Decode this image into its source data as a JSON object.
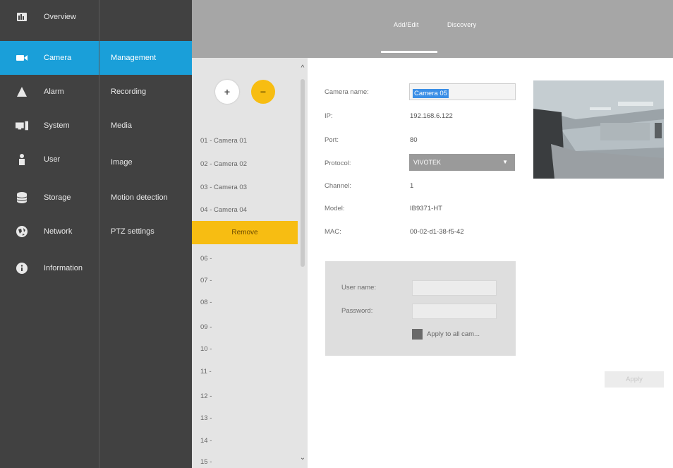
{
  "nav": {
    "items": [
      {
        "label": "Overview",
        "icon": "overview-icon"
      },
      {
        "label": "Camera",
        "icon": "camera-icon",
        "active": true
      },
      {
        "label": "Alarm",
        "icon": "alarm-icon"
      },
      {
        "label": "System",
        "icon": "system-icon"
      },
      {
        "label": "User",
        "icon": "user-icon"
      },
      {
        "label": "Storage",
        "icon": "storage-icon"
      },
      {
        "label": "Network",
        "icon": "network-icon"
      },
      {
        "label": "Information",
        "icon": "information-icon"
      }
    ]
  },
  "subnav": {
    "items": [
      {
        "label": "Management",
        "active": true
      },
      {
        "label": "Recording"
      },
      {
        "label": "Media"
      },
      {
        "label": "Image"
      },
      {
        "label": "Motion detection"
      },
      {
        "label": "PTZ settings"
      }
    ]
  },
  "header": {
    "tabs": [
      {
        "label": "Add/Edit",
        "active": true
      },
      {
        "label": "Discovery"
      }
    ]
  },
  "list": {
    "add_label": "+",
    "remove_label": "−",
    "cameras": [
      "01 - Camera 01",
      "02 - Camera 02",
      "03 - Camera 03",
      "04 - Camera 04",
      "Remove",
      "06 -",
      "07 -",
      "08 -",
      "09 -",
      "10 -",
      "11 -",
      "12 -",
      "13 -",
      "14 -",
      "15 -"
    ]
  },
  "form": {
    "camera_name_label": "Camera name:",
    "camera_name_value": "Camera 05",
    "ip_label": "IP:",
    "ip_value": "192.168.6.122",
    "port_label": "Port:",
    "port_value": "80",
    "protocol_label": "Protocol:",
    "protocol_value": "VIVOTEK",
    "channel_label": "Channel:",
    "channel_value": "1",
    "model_label": "Model:",
    "model_value": "IB9371-HT",
    "mac_label": "MAC:",
    "mac_value": "00-02-d1-38-f5-42"
  },
  "credentials": {
    "username_label": "User name:",
    "password_label": "Password:",
    "apply_all_label": "Apply to all cam..."
  },
  "actions": {
    "apply_label": "Apply"
  },
  "colors": {
    "accent": "#1a9fd9",
    "warning": "#f7bd12",
    "nav_bg": "#414141",
    "header_bg": "#a6a6a6"
  }
}
